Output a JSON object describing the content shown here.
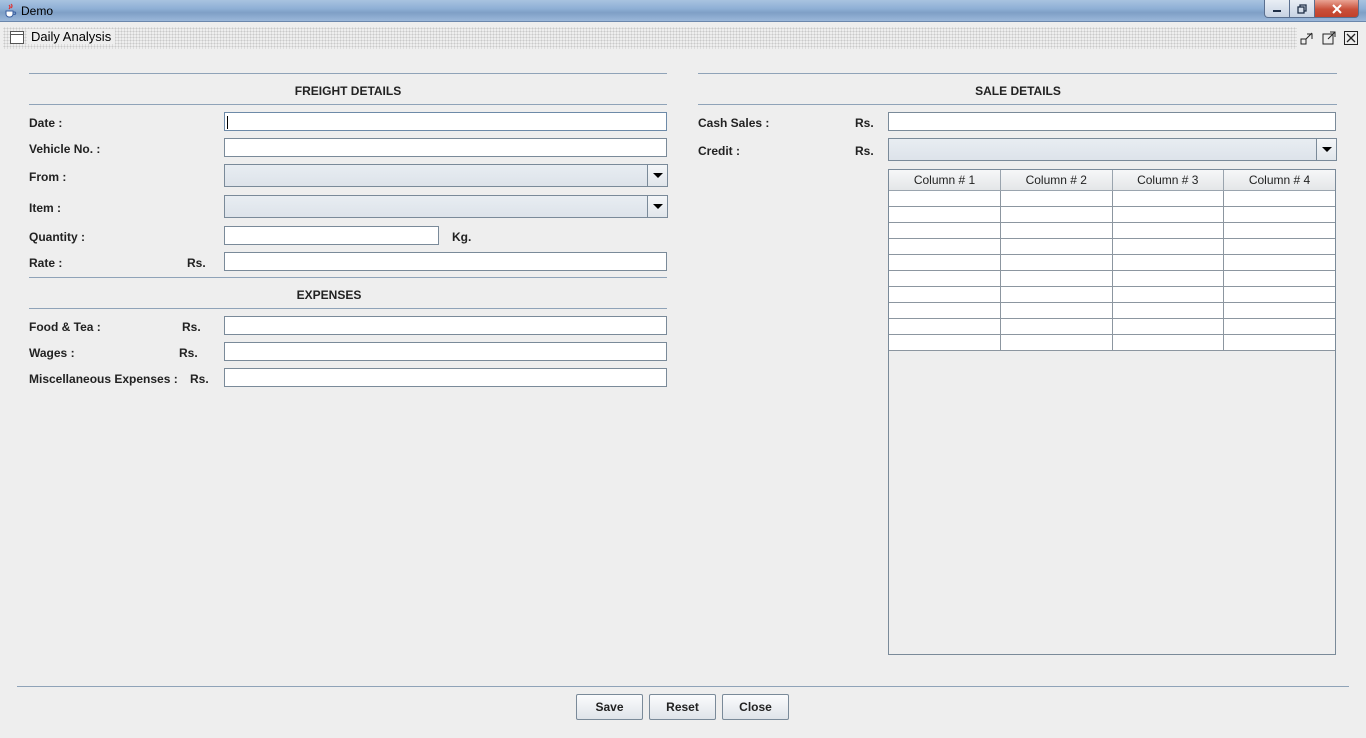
{
  "window": {
    "title": "Demo"
  },
  "internal_frame": {
    "title": "Daily Analysis"
  },
  "freight": {
    "section_title": "FREIGHT DETAILS",
    "date_label": "Date :",
    "date_value": "",
    "vehicle_label": "Vehicle No. :",
    "vehicle_value": "",
    "from_label": "From :",
    "from_value": "",
    "item_label": "Item :",
    "item_value": "",
    "quantity_label": "Quantity :",
    "quantity_value": "",
    "quantity_unit": "Kg.",
    "rate_label": "Rate :",
    "rate_currency": "Rs.",
    "rate_value": ""
  },
  "expenses": {
    "section_title": "EXPENSES",
    "food_label": "Food & Tea :",
    "food_currency": "Rs.",
    "food_value": "",
    "wages_label": "Wages :",
    "wages_currency": "Rs.",
    "wages_value": "",
    "misc_label": "Miscellaneous Expenses :",
    "misc_currency": "Rs.",
    "misc_value": ""
  },
  "sale": {
    "section_title": "SALE DETAILS",
    "cash_label": "Cash Sales :",
    "cash_currency": "Rs.",
    "cash_value": "",
    "credit_label": "Credit :",
    "credit_currency": "Rs.",
    "credit_value": ""
  },
  "table": {
    "columns": [
      "Column # 1",
      "Column # 2",
      "Column # 3",
      "Column # 4"
    ],
    "rows": [
      [
        "",
        "",
        "",
        ""
      ],
      [
        "",
        "",
        "",
        ""
      ],
      [
        "",
        "",
        "",
        ""
      ],
      [
        "",
        "",
        "",
        ""
      ],
      [
        "",
        "",
        "",
        ""
      ],
      [
        "",
        "",
        "",
        ""
      ],
      [
        "",
        "",
        "",
        ""
      ],
      [
        "",
        "",
        "",
        ""
      ],
      [
        "",
        "",
        "",
        ""
      ],
      [
        "",
        "",
        "",
        ""
      ]
    ]
  },
  "buttons": {
    "save": "Save",
    "reset": "Reset",
    "close": "Close"
  },
  "icons": {
    "app": "java-cup-icon",
    "frame": "window-icon",
    "iconify": "iconify-icon",
    "maximize": "maximize-icon",
    "close": "close-icon"
  }
}
